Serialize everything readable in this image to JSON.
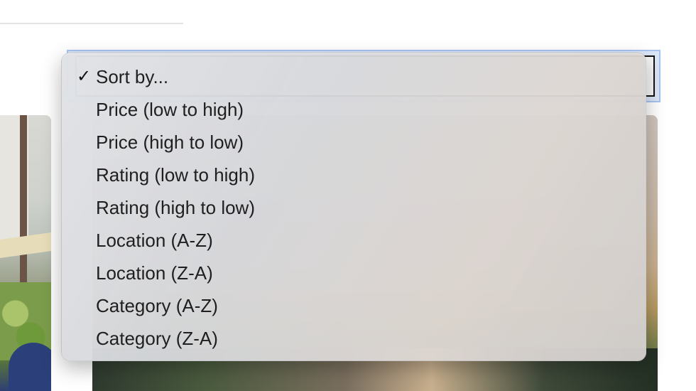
{
  "sort_select": {
    "selected": "Sort by...",
    "options": [
      "Sort by...",
      "Price (low to high)",
      "Price (high to low)",
      "Rating (low to high)",
      "Rating (high to low)",
      "Location (A-Z)",
      "Location (Z-A)",
      "Category (A-Z)",
      "Category (Z-A)"
    ],
    "checkmark": "✓"
  },
  "colors": {
    "menu_text": "#1f1f1f",
    "focus_ring": "#a9c4f3"
  },
  "icons": {
    "checkmark_icon": "checkmark-icon"
  }
}
